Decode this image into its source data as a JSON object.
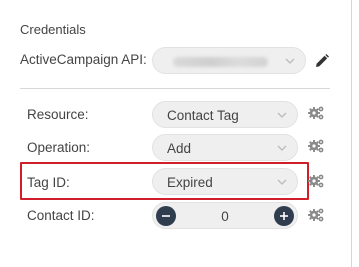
{
  "credentials": {
    "title": "Credentials",
    "api_label": "ActiveCampaign API:"
  },
  "fields": {
    "resource": {
      "label": "Resource:",
      "value": "Contact Tag"
    },
    "operation": {
      "label": "Operation:",
      "value": "Add"
    },
    "tag_id": {
      "label": "Tag ID:",
      "value": "Expired"
    },
    "contact_id": {
      "label": "Contact ID:",
      "value": "0"
    }
  },
  "icons": {
    "edit": "pencil-icon",
    "settings": "gears-icon",
    "dropdown": "chevron-down-icon",
    "decrement": "minus-icon",
    "increment": "plus-icon"
  },
  "colors": {
    "highlight_border": "#d01f2a",
    "stepper_button": "#2f3d4f",
    "gear": "#8a8a8a"
  }
}
